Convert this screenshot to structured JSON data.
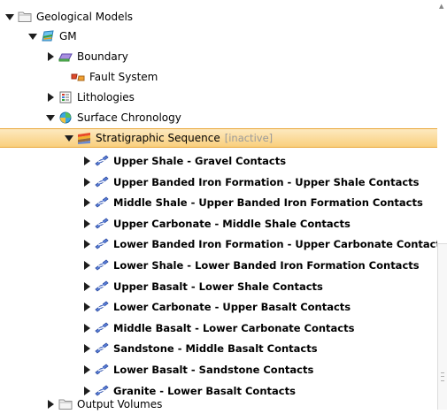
{
  "tree": {
    "root": {
      "label": "Geological Models",
      "expanded": true,
      "icon": "folder-icon"
    },
    "model": {
      "label": "GM",
      "expanded": true,
      "icon": "geomodel-icon"
    },
    "boundary": {
      "label": "Boundary",
      "icon": "boundary-icon"
    },
    "fault_system": {
      "label": "Fault System",
      "icon": "fault-system-icon"
    },
    "lithologies": {
      "label": "Lithologies",
      "icon": "lithologies-icon"
    },
    "surface_chronology": {
      "label": "Surface Chronology",
      "expanded": true,
      "icon": "chronology-icon"
    },
    "stratigraphic_sequence": {
      "label": "Stratigraphic Sequence",
      "status": "[inactive]",
      "selected": true,
      "icon": "stratigraphy-icon"
    },
    "contacts": [
      {
        "label": "Upper Shale - Gravel Contacts"
      },
      {
        "label": "Upper Banded Iron Formation - Upper Shale Contacts"
      },
      {
        "label": "Middle Shale - Upper Banded Iron Formation Contacts"
      },
      {
        "label": "Upper Carbonate - Middle Shale Contacts"
      },
      {
        "label": "Lower Banded Iron Formation - Upper Carbonate Contacts"
      },
      {
        "label": "Lower Shale - Lower Banded Iron Formation Contacts"
      },
      {
        "label": "Upper Basalt - Lower Shale Contacts"
      },
      {
        "label": "Lower Carbonate - Upper Basalt Contacts"
      },
      {
        "label": "Middle Basalt - Lower Carbonate Contacts"
      },
      {
        "label": "Sandstone - Middle Basalt Contacts"
      },
      {
        "label": "Lower Basalt - Sandstone Contacts"
      },
      {
        "label": "Granite - Lower Basalt Contacts"
      }
    ],
    "output_volumes": {
      "label": "Output Volumes",
      "icon": "folder-icon"
    }
  },
  "colors": {
    "selection_top": "#fde9bf",
    "selection_bottom": "#f9cf7d",
    "selection_border": "#e9a73a",
    "inactive_text": "#9a9a9a"
  }
}
